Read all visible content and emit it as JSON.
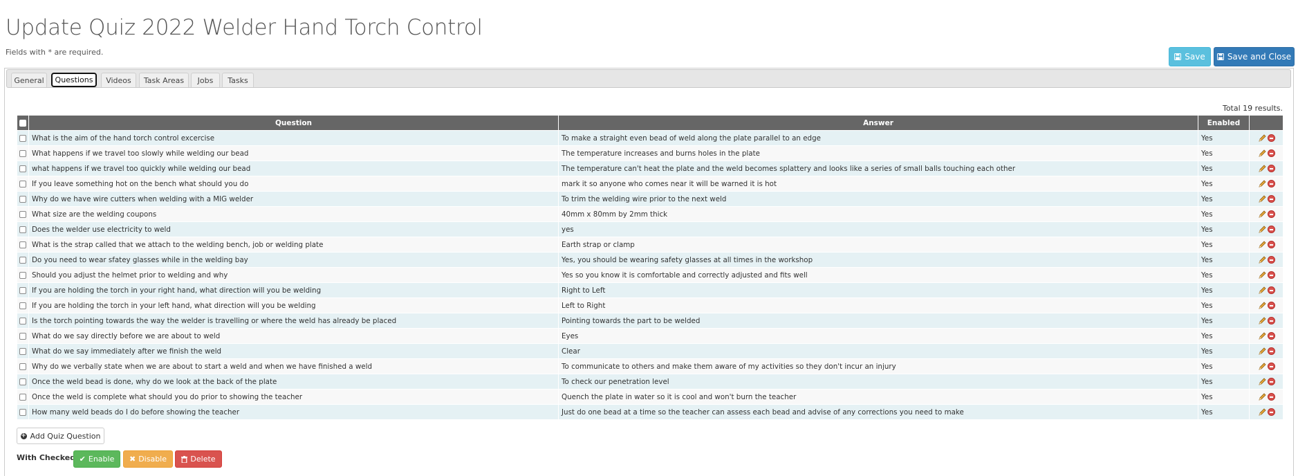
{
  "page": {
    "title": "Update Quiz 2022 Welder Hand Torch Control",
    "required_note": "Fields with * are required."
  },
  "toolbar": {
    "save_label": "Save",
    "save_close_label": "Save and Close"
  },
  "tabs": [
    "General",
    "Questions",
    "Videos",
    "Task Areas",
    "Jobs",
    "Tasks"
  ],
  "active_tab": "Questions",
  "results": {
    "total_label": "Total 19 results."
  },
  "table": {
    "headers": {
      "question": "Question",
      "answer": "Answer",
      "enabled": "Enabled"
    },
    "rows": [
      {
        "question": "What is the aim of the hand torch control excercise",
        "answer": "To make a straight even bead of weld along the plate parallel to an edge",
        "enabled": "Yes"
      },
      {
        "question": "What happens if we travel too slowly while welding our bead",
        "answer": "The temperature increases and burns holes in the plate",
        "enabled": "Yes"
      },
      {
        "question": "what happens if we travel too quickly while welding our bead",
        "answer": "The temperature can't heat the plate and the weld becomes splattery and looks like a series of small balls touching each other",
        "enabled": "Yes"
      },
      {
        "question": "If you leave something hot on the bench what should you do",
        "answer": "mark it so anyone who comes near it will be warned it is hot",
        "enabled": "Yes"
      },
      {
        "question": "Why do we have wire cutters when welding with a MIG welder",
        "answer": "To trim the welding wire prior to the next weld",
        "enabled": "Yes"
      },
      {
        "question": "What size are the welding coupons",
        "answer": "40mm x 80mm by 2mm thick",
        "enabled": "Yes"
      },
      {
        "question": "Does the welder use electricity to weld",
        "answer": "yes",
        "enabled": "Yes"
      },
      {
        "question": "What is the strap called that we attach to the welding bench, job or welding plate",
        "answer": "Earth strap or clamp",
        "enabled": "Yes"
      },
      {
        "question": "Do you need to wear sfatey glasses while in the welding bay",
        "answer": "Yes, you should be wearing safety glasses at all times in the workshop",
        "enabled": "Yes"
      },
      {
        "question": "Should you adjust the helmet prior to welding and why",
        "answer": "Yes so you know it is comfortable and correctly adjusted and fits well",
        "enabled": "Yes"
      },
      {
        "question": "If you are holding the torch in your right hand, what direction will you be welding",
        "answer": "Right to Left",
        "enabled": "Yes"
      },
      {
        "question": "If you are holding the torch in your left hand, what direction will you be welding",
        "answer": "Left to Right",
        "enabled": "Yes"
      },
      {
        "question": "Is the torch pointing towards the way the welder is travelling or where the weld has already be placed",
        "answer": "Pointing towards the part to be welded",
        "enabled": "Yes"
      },
      {
        "question": "What do we say directly before we are about to weld",
        "answer": "Eyes",
        "enabled": "Yes"
      },
      {
        "question": "What do we say immediately after we finish the weld",
        "answer": "Clear",
        "enabled": "Yes"
      },
      {
        "question": "Why do we verbally state when we are about to start a weld and when we have finished a weld",
        "answer": "To communicate to others and make them aware of my activities so they don't incur an injury",
        "enabled": "Yes"
      },
      {
        "question": "Once the weld bead is done, why do we look at the back of the plate",
        "answer": "To check our penetration level",
        "enabled": "Yes"
      },
      {
        "question": "Once the weld is complete what should you do prior to showing the teacher",
        "answer": "Quench the plate in water so it is cool and won't burn the teacher",
        "enabled": "Yes"
      },
      {
        "question": "How many weld beads do I do before showing the teacher",
        "answer": "Just do one bead at a time so the teacher can assess each bead and advise of any corrections you need to make",
        "enabled": "Yes"
      }
    ]
  },
  "add_button_label": "Add Quiz Question",
  "bulk": {
    "label": "With Checked:",
    "enable_label": "Enable",
    "disable_label": "Disable",
    "delete_label": "Delete"
  },
  "icons": {
    "save": "floppy-disk-icon",
    "edit": "pencil-icon",
    "delete_row": "minus-circle-icon",
    "add": "plus-circle-icon",
    "enable": "check-icon",
    "disable": "x-icon",
    "delete": "trash-icon"
  },
  "colors": {
    "save": "#5bc0de",
    "save_close": "#337ab7",
    "enable": "#5cb85c",
    "disable": "#f0ad4e",
    "delete": "#d9534f",
    "header_bg": "#666666",
    "row_odd": "#e5f1f4"
  }
}
